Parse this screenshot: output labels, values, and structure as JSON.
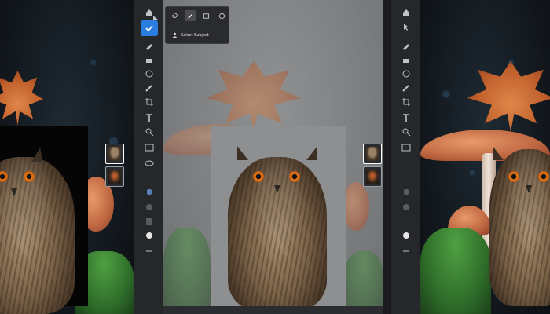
{
  "popup": {
    "select_subject_label": "Select Subject"
  },
  "icons": {
    "toolbar": [
      "home-icon",
      "move-icon",
      "brush-icon",
      "eraser-icon",
      "lasso-icon",
      "crop-icon",
      "type-icon",
      "image-icon",
      "eyedropper-icon",
      "color-swatch-icon",
      "zoom-icon",
      "hand-icon",
      "more-icon"
    ],
    "popup_tools": [
      "lasso-icon",
      "brush-icon",
      "rectangle-select-icon",
      "ellipse-select-icon"
    ]
  },
  "colors": {
    "accent": "#2c7de0",
    "toolbar_bg": "#26272b",
    "gray_canvas": "#7c7e80"
  }
}
